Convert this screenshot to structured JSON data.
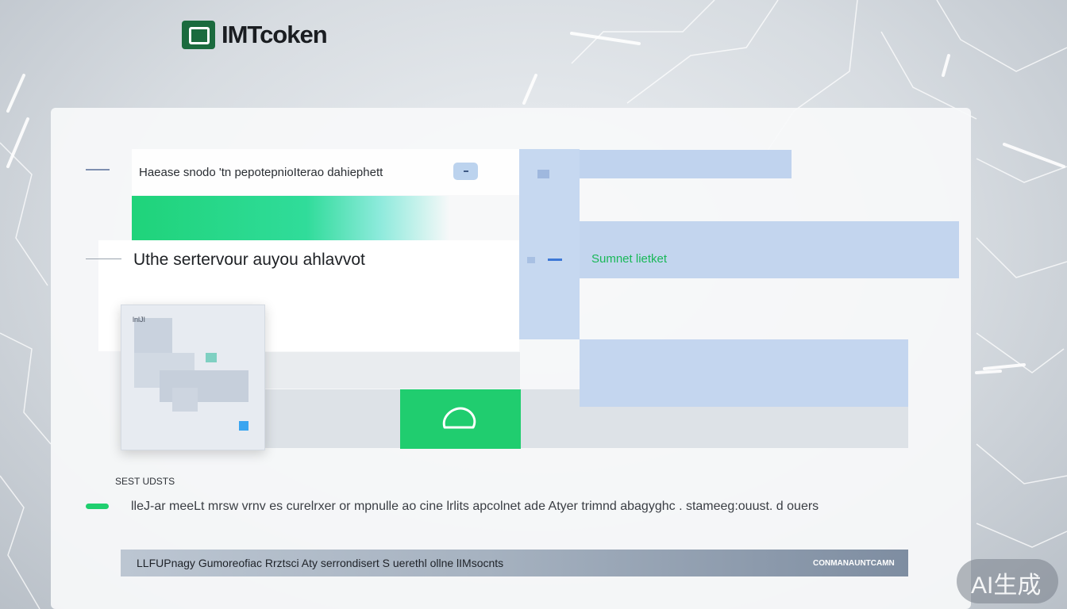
{
  "app": {
    "brand": "IMTcoken",
    "logo_icon": "wallet-logo-icon",
    "accent_green": "#20cd6f",
    "accent_blue": "#c3d5ee"
  },
  "card": {
    "notice_text": "Haease snodo 'tn pepotepnioIterao dahiephett",
    "notice_pill_icon": "minus-icon",
    "heading": "Uthe sertervour auyou ahlavvot",
    "qr_tag": "lnlJI",
    "confirm_icon": "circle-icon",
    "summary_label": "Sumnet lietket"
  },
  "section": {
    "label": "SEST UDSTS",
    "description": "lleJ-ar meeLt mrsw vrnv es curelrxer or mpnulle ao cine lrlits apcolnet ade Atyer trimnd abagyghc . stameeg:ouust. d ouers"
  },
  "footer": {
    "text": "LLFUPnagy Gumoreofiac Rrztsci Aty serrondisert S uerethl ollne lIMsocnts",
    "right_label": "CONMANAUNTCAMN"
  },
  "watermark": {
    "text": "AI生成"
  }
}
